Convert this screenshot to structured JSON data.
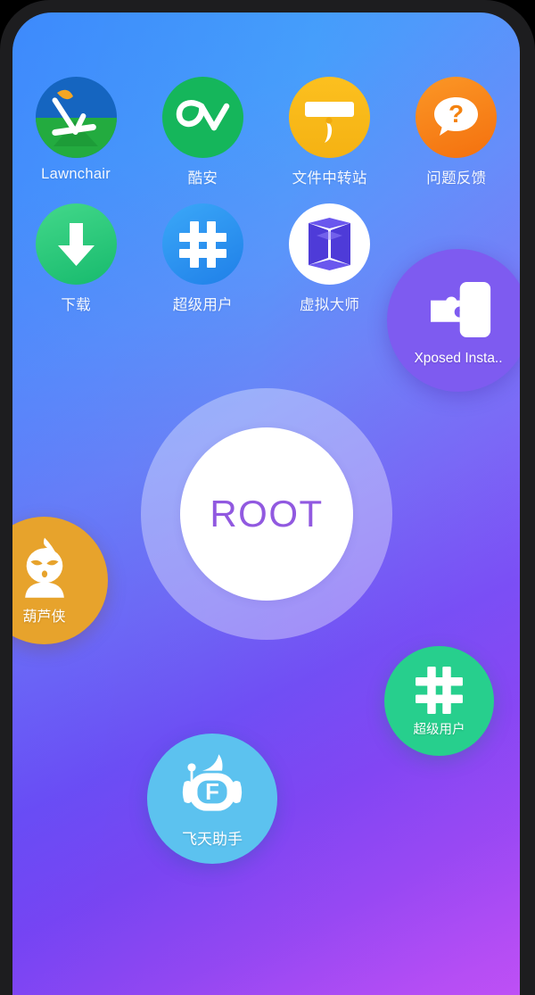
{
  "device": {
    "frame_color": "#1d1d1f",
    "screen_gradient_start": "#3d9bfb",
    "screen_gradient_end": "#bb50f4"
  },
  "home": {
    "apps": [
      {
        "id": "lawnchair",
        "label": "Lawnchair",
        "icon": "lawnchair-icon",
        "color": "#1565c0"
      },
      {
        "id": "coolapk",
        "label": "酷安",
        "icon": "coolapk-icon",
        "color": "#15b65b"
      },
      {
        "id": "filetransfer",
        "label": "文件中转站",
        "icon": "file-transfer-icon",
        "color": "#fcc01f"
      },
      {
        "id": "feedback",
        "label": "问题反馈",
        "icon": "question-mark-icon",
        "color": "#f4700e"
      },
      {
        "id": "download",
        "label": "下载",
        "icon": "download-arrow-icon",
        "color": "#17ba6d"
      },
      {
        "id": "superuser",
        "label": "超级用户",
        "icon": "hash-icon",
        "color": "#1f7fe8"
      },
      {
        "id": "virtual",
        "label": "虚拟大师",
        "icon": "cube-icon",
        "color": "#5b4bd6"
      }
    ]
  },
  "floating_items": [
    {
      "id": "xposed",
      "label": "Xposed Insta..",
      "icon": "puzzle-piece-icon",
      "color": "#7e5bf0"
    },
    {
      "id": "huluxia",
      "label": "葫芦侠",
      "icon": "gourd-mascot-icon",
      "color": "#e7a32c"
    },
    {
      "id": "superuser2",
      "label": "超级用户",
      "icon": "hash-icon",
      "color": "#27cf8d"
    },
    {
      "id": "feitian",
      "label": "飞天助手",
      "icon": "robot-f-icon",
      "color": "#5cc2ef"
    }
  ],
  "root_button": {
    "label": "ROOT",
    "text_color": "#9159e0",
    "ring_color": "rgba(255,255,255,0.34)",
    "inner_color": "#ffffff"
  }
}
